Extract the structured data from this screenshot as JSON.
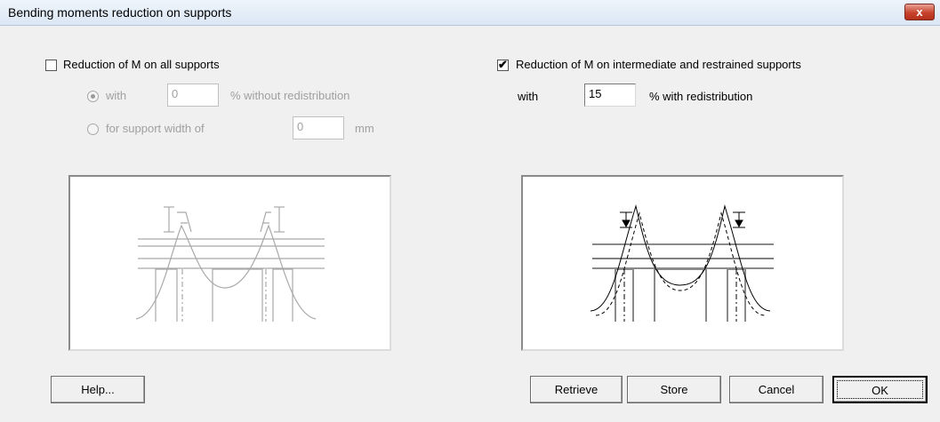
{
  "window": {
    "title": "Bending moments reduction on supports",
    "close_label": "x"
  },
  "left": {
    "checkbox_label": "Reduction of M on all supports",
    "checked": false,
    "option_with_label": "with",
    "option_with_value": "0",
    "option_with_suffix": "% without redistribution",
    "option_width_label": "for support width of",
    "option_width_value": "0",
    "option_width_unit": "mm"
  },
  "right": {
    "checkbox_label": "Reduction of M on intermediate and restrained supports",
    "checked": true,
    "with_label": "with",
    "with_value": "15",
    "with_suffix": "% with redistribution"
  },
  "buttons": {
    "help": "Help...",
    "retrieve": "Retrieve",
    "store": "Store",
    "cancel": "Cancel",
    "ok": "OK"
  }
}
